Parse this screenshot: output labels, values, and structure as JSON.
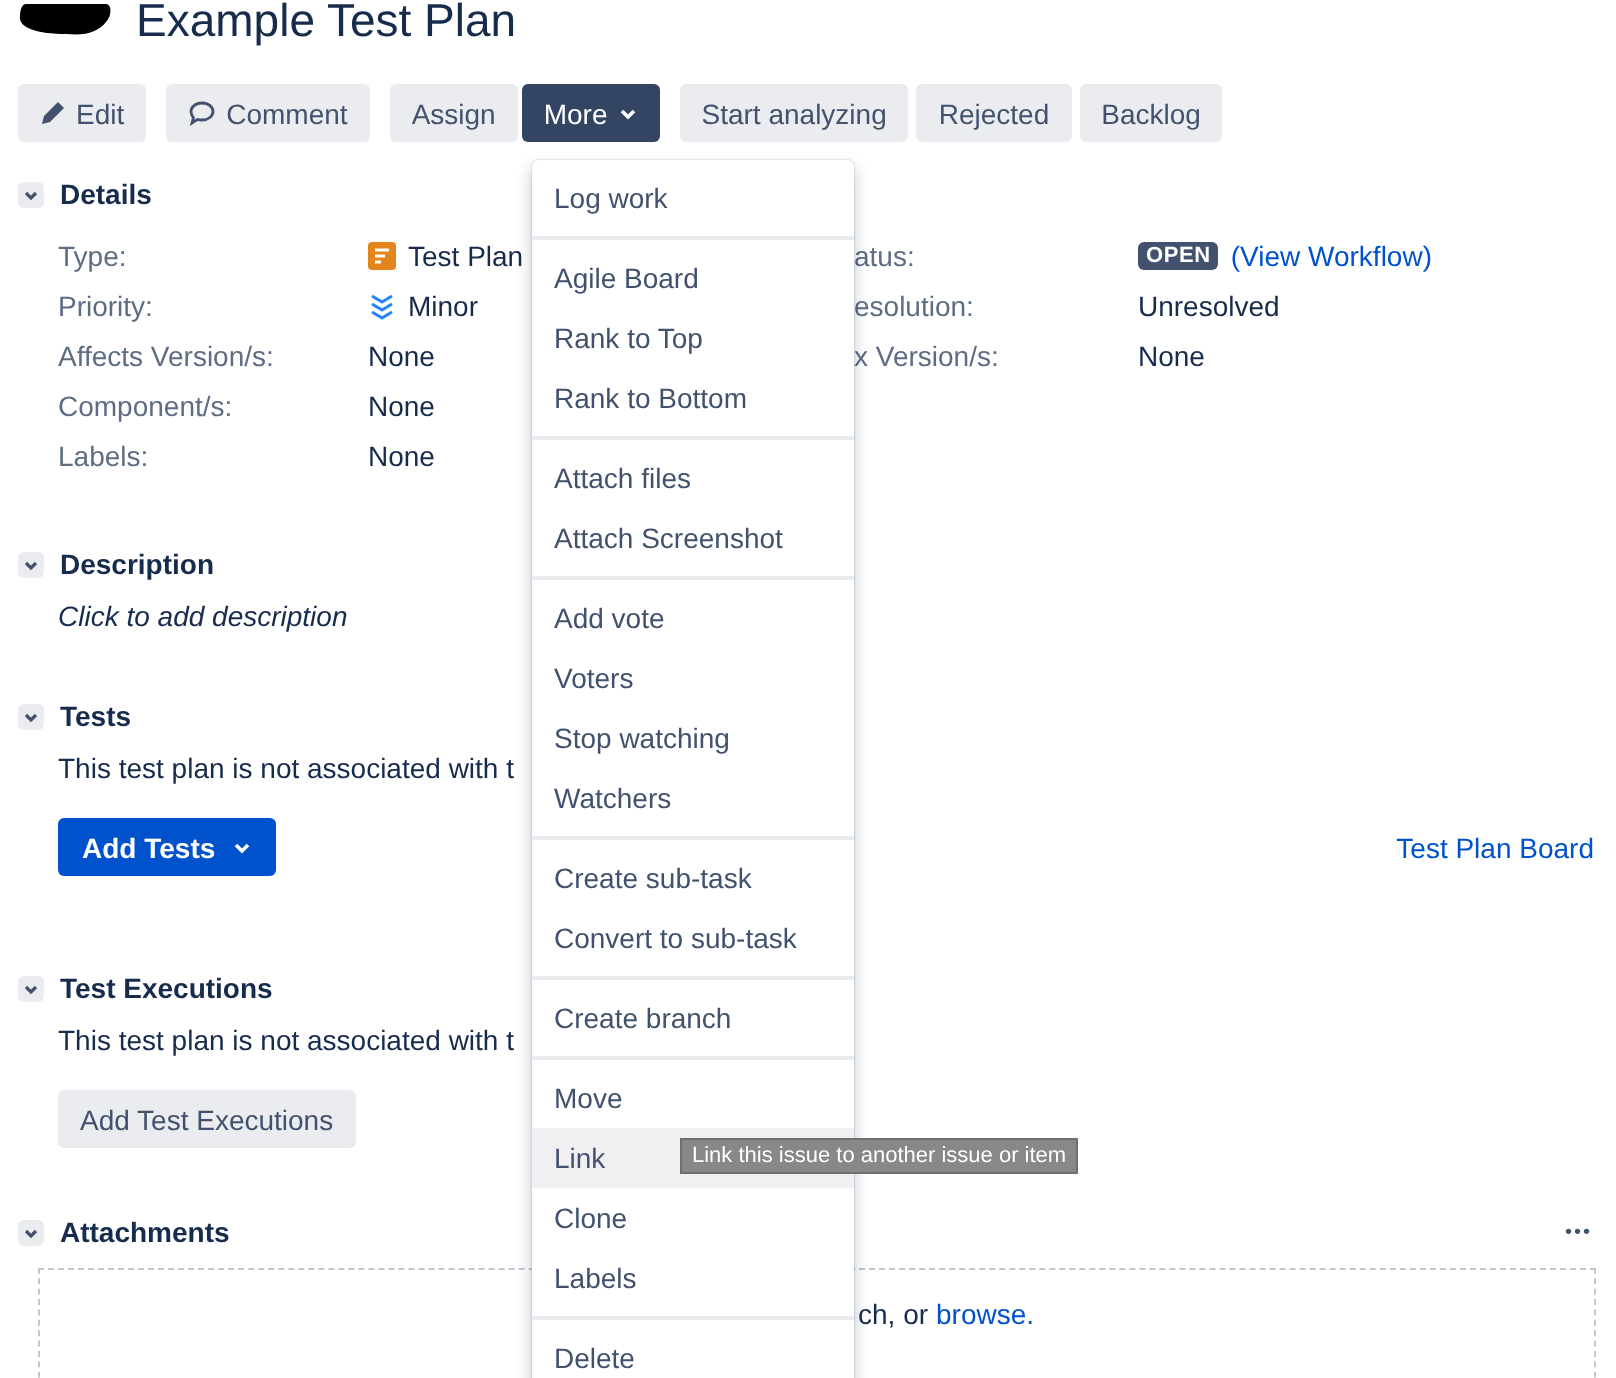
{
  "header": {
    "title": "Example Test Plan"
  },
  "toolbar": [
    {
      "label": "Edit",
      "kind": "edit",
      "selected": false
    },
    {
      "label": "Comment",
      "kind": "comment",
      "selected": false
    },
    {
      "label": "Assign",
      "kind": "plain",
      "selected": false
    },
    {
      "label": "More",
      "kind": "dropdown",
      "selected": true
    },
    {
      "label": "Start analyzing",
      "kind": "plain",
      "selected": false
    },
    {
      "label": "Rejected",
      "kind": "plain",
      "selected": false
    },
    {
      "label": "Backlog",
      "kind": "plain",
      "selected": false
    }
  ],
  "details": {
    "title": "Details",
    "expanded": true,
    "left": [
      {
        "label": "Type:",
        "value": "Test Plan",
        "kind": "test-plan"
      },
      {
        "label": "Priority:",
        "value": "Minor",
        "kind": "priority"
      },
      {
        "label": "Affects Version/s:",
        "value": "None"
      },
      {
        "label": "Component/s:",
        "value": "None"
      },
      {
        "label": "Labels:",
        "value": "None"
      }
    ],
    "right": [
      {
        "label": "atus:",
        "badge": "OPEN",
        "link": "(View Workflow)"
      },
      {
        "label": "esolution:",
        "value": "Unresolved"
      },
      {
        "label": "x Version/s:",
        "value": "None"
      }
    ]
  },
  "description": {
    "title": "Description",
    "expanded": true,
    "placeholder": "Click to add description"
  },
  "tests": {
    "title": "Tests",
    "expanded": true,
    "text": "This test plan is not associated with t",
    "button": "Add Tests",
    "board_link": "Test Plan Board"
  },
  "test_executions": {
    "title": "Test Executions",
    "expanded": true,
    "text": "This test plan is not associated with t",
    "button": "Add Test Executions"
  },
  "attachments": {
    "title": "Attachments",
    "expanded": true,
    "more": "•••",
    "drop_text": "ch, or",
    "drop_link": "browse."
  },
  "menu": {
    "groups": [
      [
        {
          "label": "Log work",
          "selected": false
        }
      ],
      [
        {
          "label": "Agile Board",
          "selected": false
        },
        {
          "label": "Rank to Top",
          "selected": false
        },
        {
          "label": "Rank to Bottom",
          "selected": false
        }
      ],
      [
        {
          "label": "Attach files",
          "selected": false
        },
        {
          "label": "Attach Screenshot",
          "selected": false
        }
      ],
      [
        {
          "label": "Add vote",
          "selected": false
        },
        {
          "label": "Voters",
          "selected": false
        },
        {
          "label": "Stop watching",
          "selected": false
        },
        {
          "label": "Watchers",
          "selected": false
        }
      ],
      [
        {
          "label": "Create sub-task",
          "selected": false
        },
        {
          "label": "Convert to sub-task",
          "selected": false
        }
      ],
      [
        {
          "label": "Create branch",
          "selected": false
        }
      ],
      [
        {
          "label": "Move",
          "selected": false
        },
        {
          "label": "Link",
          "selected": true
        },
        {
          "label": "Clone",
          "selected": false
        },
        {
          "label": "Labels",
          "selected": false
        }
      ],
      [
        {
          "label": "Delete",
          "selected": false
        }
      ]
    ]
  },
  "tooltip": {
    "text": "Link this issue to another issue or item"
  }
}
